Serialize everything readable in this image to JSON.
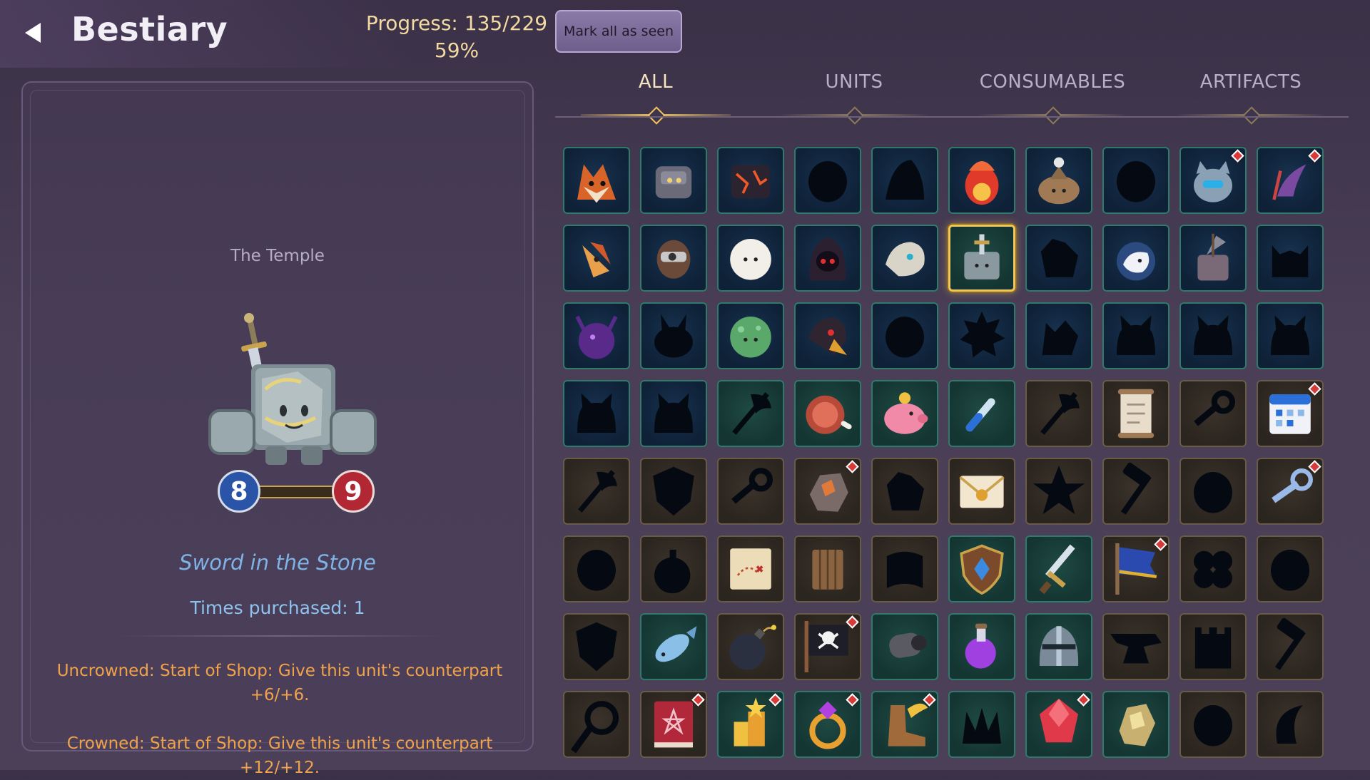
{
  "header": {
    "title": "Bestiary",
    "progress_line1": "Progress: 135/229",
    "progress_line2": "59%",
    "mark_all_label": "Mark all as seen",
    "back_icon": "back-arrow-icon"
  },
  "detail": {
    "location": "The Temple",
    "attack": "8",
    "health": "9",
    "name": "Sword in the Stone",
    "times_purchased": "Times purchased: 1",
    "ability_uncrowned": "Uncrowned: Start of Shop: Give this unit's counterpart +6/+6.",
    "ability_crowned": "Crowned: Start of Shop: Give this unit's counterpart +12/+12."
  },
  "tabs": [
    {
      "label": "ALL",
      "active": true
    },
    {
      "label": "UNITS",
      "active": false
    },
    {
      "label": "CONSUMABLES",
      "active": false
    },
    {
      "label": "ARTIFACTS",
      "active": false
    }
  ],
  "grid": {
    "selected": "sword-in-stone",
    "rows": [
      [
        {
          "icon": "fox",
          "bg": "navy",
          "known": true,
          "new": false
        },
        {
          "icon": "stone-golem",
          "bg": "navy",
          "known": true,
          "new": false
        },
        {
          "icon": "lava-golem",
          "bg": "navy",
          "known": true,
          "new": false
        },
        {
          "icon": "silhouette-blob",
          "bg": "navy",
          "known": false,
          "new": false
        },
        {
          "icon": "silhouette-hood",
          "bg": "navy",
          "known": false,
          "new": false
        },
        {
          "icon": "phoenix",
          "bg": "navy",
          "known": true,
          "new": false
        },
        {
          "icon": "volcano-slime",
          "bg": "navy",
          "known": true,
          "new": false
        },
        {
          "icon": "silhouette-blob",
          "bg": "navy",
          "known": false,
          "new": false
        },
        {
          "icon": "robot-cat",
          "bg": "navy",
          "known": true,
          "new": true
        },
        {
          "icon": "purple-claw",
          "bg": "navy",
          "known": true,
          "new": true
        }
      ],
      [
        {
          "icon": "fire-bird",
          "bg": "navy",
          "known": true,
          "new": false
        },
        {
          "icon": "knight-helm",
          "bg": "navy",
          "known": true,
          "new": false
        },
        {
          "icon": "cotton-ball",
          "bg": "navy",
          "known": true,
          "new": false
        },
        {
          "icon": "hooded-shade",
          "bg": "navy",
          "known": true,
          "new": false
        },
        {
          "icon": "bone-beast",
          "bg": "navy",
          "known": true,
          "new": false
        },
        {
          "icon": "sword-in-stone",
          "bg": "teal",
          "known": true,
          "new": false
        },
        {
          "icon": "silhouette-crystal",
          "bg": "navy",
          "known": false,
          "new": false
        },
        {
          "icon": "unicorn",
          "bg": "navy",
          "known": true,
          "new": false
        },
        {
          "icon": "axe-stone",
          "bg": "navy",
          "known": true,
          "new": false
        },
        {
          "icon": "silhouette-horned",
          "bg": "navy",
          "known": false,
          "new": false
        }
      ],
      [
        {
          "icon": "purple-beetle",
          "bg": "navy",
          "known": true,
          "new": false
        },
        {
          "icon": "silhouette-rabbit",
          "bg": "navy",
          "known": false,
          "new": false
        },
        {
          "icon": "moss-slime",
          "bg": "navy",
          "known": true,
          "new": false
        },
        {
          "icon": "dark-bird",
          "bg": "navy",
          "known": true,
          "new": false
        },
        {
          "icon": "silhouette-blob",
          "bg": "navy",
          "known": false,
          "new": false
        },
        {
          "icon": "silhouette-spiky",
          "bg": "navy",
          "known": false,
          "new": false
        },
        {
          "icon": "silhouette-wolf",
          "bg": "navy",
          "known": false,
          "new": false
        },
        {
          "icon": "silhouette-cat",
          "bg": "navy",
          "known": false,
          "new": false
        },
        {
          "icon": "silhouette-cat",
          "bg": "navy",
          "known": false,
          "new": false
        },
        {
          "icon": "silhouette-cat",
          "bg": "navy",
          "known": false,
          "new": false
        }
      ],
      [
        {
          "icon": "silhouette-cat",
          "bg": "navy",
          "known": false,
          "new": false
        },
        {
          "icon": "silhouette-cat",
          "bg": "navy",
          "known": false,
          "new": false
        },
        {
          "icon": "silhouette-axe",
          "bg": "teal",
          "known": false,
          "new": false
        },
        {
          "icon": "ham",
          "bg": "teal",
          "known": true,
          "new": false
        },
        {
          "icon": "piggy-bank",
          "bg": "teal",
          "known": true,
          "new": false
        },
        {
          "icon": "potion-vial",
          "bg": "teal",
          "known": true,
          "new": false
        },
        {
          "icon": "silhouette-axe",
          "bg": "brown",
          "known": false,
          "new": false
        },
        {
          "icon": "scroll",
          "bg": "brown",
          "known": true,
          "new": false
        },
        {
          "icon": "silhouette-key",
          "bg": "brown",
          "known": false,
          "new": false
        },
        {
          "icon": "calendar",
          "bg": "brown",
          "known": true,
          "new": true
        }
      ],
      [
        {
          "icon": "silhouette-axe",
          "bg": "brown",
          "known": false,
          "new": false
        },
        {
          "icon": "silhouette-shield",
          "bg": "brown",
          "known": false,
          "new": false
        },
        {
          "icon": "silhouette-key",
          "bg": "brown",
          "known": false,
          "new": false
        },
        {
          "icon": "ore-chunk",
          "bg": "brown",
          "known": true,
          "new": true
        },
        {
          "icon": "silhouette-crystal",
          "bg": "brown",
          "known": false,
          "new": false
        },
        {
          "icon": "envelope",
          "bg": "brown",
          "known": true,
          "new": false
        },
        {
          "icon": "silhouette-star",
          "bg": "brown",
          "known": false,
          "new": false
        },
        {
          "icon": "silhouette-hammer",
          "bg": "brown",
          "known": false,
          "new": false
        },
        {
          "icon": "silhouette-blob",
          "bg": "brown",
          "known": false,
          "new": false
        },
        {
          "icon": "crystal-key",
          "bg": "brown",
          "known": true,
          "new": true
        }
      ],
      [
        {
          "icon": "silhouette-blob",
          "bg": "brown",
          "known": false,
          "new": false
        },
        {
          "icon": "silhouette-bomb",
          "bg": "brown",
          "known": false,
          "new": false
        },
        {
          "icon": "treasure-map",
          "bg": "brown",
          "known": true,
          "new": false
        },
        {
          "icon": "wooden-crate",
          "bg": "brown",
          "known": true,
          "new": false
        },
        {
          "icon": "silhouette-scroll",
          "bg": "brown",
          "known": false,
          "new": false
        },
        {
          "icon": "shield-gem",
          "bg": "teal",
          "known": true,
          "new": false
        },
        {
          "icon": "sword",
          "bg": "teal",
          "known": true,
          "new": false
        },
        {
          "icon": "blue-flag",
          "bg": "brown",
          "known": true,
          "new": true
        },
        {
          "icon": "silhouette-clover",
          "bg": "brown",
          "known": false,
          "new": false
        },
        {
          "icon": "silhouette-blob",
          "bg": "brown",
          "known": false,
          "new": false
        }
      ],
      [
        {
          "icon": "silhouette-shield",
          "bg": "brown",
          "known": false,
          "new": false
        },
        {
          "icon": "fish",
          "bg": "teal",
          "known": true,
          "new": false
        },
        {
          "icon": "bomb",
          "bg": "brown",
          "known": true,
          "new": false
        },
        {
          "icon": "pirate-flag",
          "bg": "brown",
          "known": true,
          "new": true
        },
        {
          "icon": "cannon",
          "bg": "teal",
          "known": true,
          "new": false
        },
        {
          "icon": "purple-potion",
          "bg": "teal",
          "known": true,
          "new": false
        },
        {
          "icon": "knight-helmet",
          "bg": "teal",
          "known": true,
          "new": false
        },
        {
          "icon": "silhouette-anvil",
          "bg": "brown",
          "known": false,
          "new": false
        },
        {
          "icon": "silhouette-tower",
          "bg": "brown",
          "known": false,
          "new": false
        },
        {
          "icon": "silhouette-hammer",
          "bg": "brown",
          "known": false,
          "new": false
        }
      ],
      [
        {
          "icon": "silhouette-rope",
          "bg": "brown",
          "known": false,
          "new": false
        },
        {
          "icon": "spell-book",
          "bg": "brown",
          "known": true,
          "new": true
        },
        {
          "icon": "trophy-blocks",
          "bg": "teal",
          "known": true,
          "new": true
        },
        {
          "icon": "gold-ring",
          "bg": "teal",
          "known": true,
          "new": true
        },
        {
          "icon": "winged-boot",
          "bg": "teal",
          "known": true,
          "new": true
        },
        {
          "icon": "silhouette-fang",
          "bg": "teal",
          "known": false,
          "new": false
        },
        {
          "icon": "red-gem",
          "bg": "teal",
          "known": true,
          "new": true
        },
        {
          "icon": "gold-ore",
          "bg": "teal",
          "known": true,
          "new": false
        },
        {
          "icon": "silhouette-blob",
          "bg": "brown",
          "known": false,
          "new": false
        },
        {
          "icon": "silhouette-crescent",
          "bg": "brown",
          "known": false,
          "new": false
        }
      ]
    ]
  }
}
